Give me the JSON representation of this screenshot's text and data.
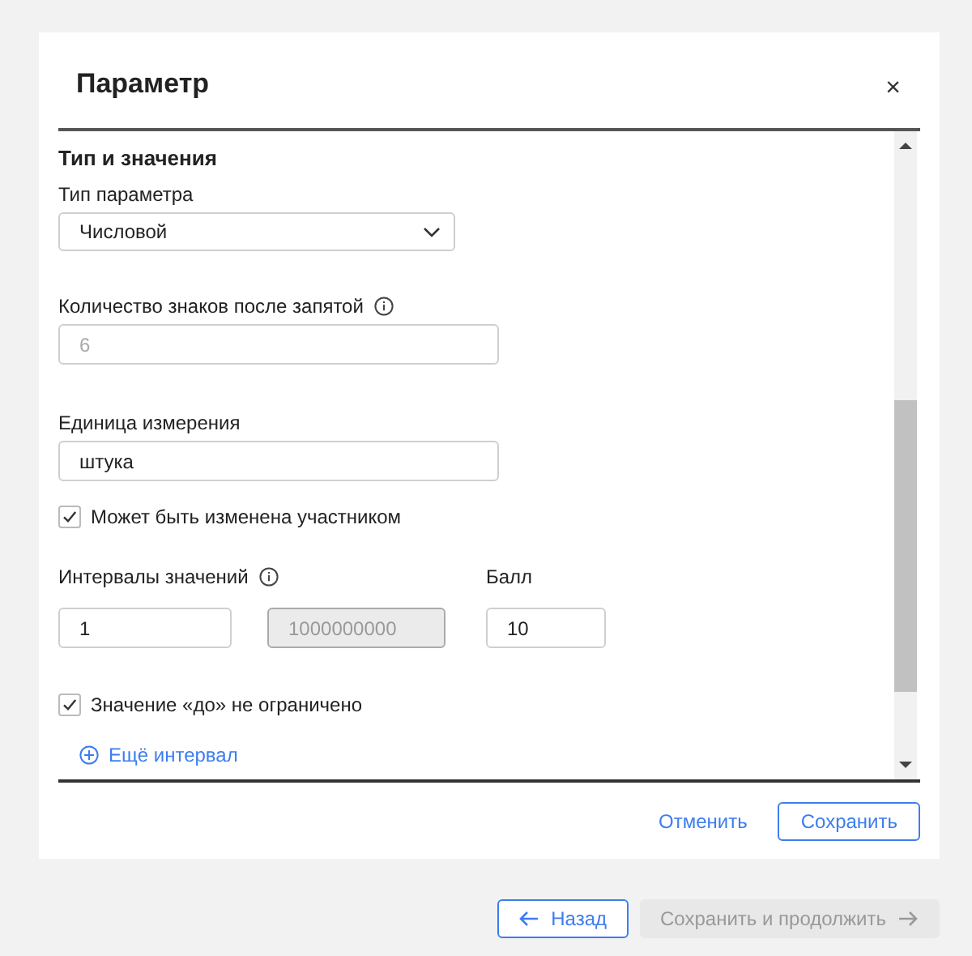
{
  "dialog": {
    "title": "Параметр",
    "close": "×"
  },
  "section": {
    "title": "Тип и значения",
    "param_type": {
      "label": "Тип параметра",
      "value": "Числовой"
    },
    "decimals": {
      "label": "Количество знаков после запятой",
      "placeholder": "6"
    },
    "unit": {
      "label": "Единица измерения",
      "value": "штука"
    },
    "editable": {
      "label": "Может быть изменена участником",
      "checked": true
    },
    "intervals": {
      "label": "Интервалы значений",
      "score_label": "Балл",
      "rows": [
        {
          "from": "1",
          "to": "1000000000",
          "to_disabled": true,
          "score": "10"
        }
      ]
    },
    "unbounded": {
      "label": "Значение «до» не ограничено",
      "checked": true
    },
    "add_interval": "Ещё интервал"
  },
  "footer": {
    "cancel": "Отменить",
    "save": "Сохранить"
  },
  "page_nav": {
    "back": {
      "label": "Назад",
      "disabled": false
    },
    "next": {
      "label": "Сохранить и продолжить",
      "disabled": true
    }
  }
}
